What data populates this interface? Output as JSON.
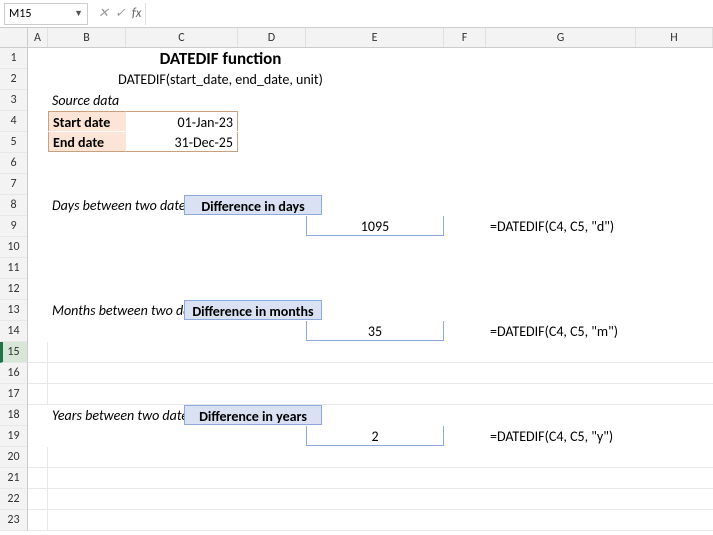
{
  "nameBox": "M15",
  "formulaInput": "",
  "columns": [
    "A",
    "B",
    "C",
    "D",
    "E",
    "F",
    "G",
    "H"
  ],
  "rowCount": 23,
  "activeRow": 15,
  "title": "DATEDIF function",
  "subtitle": "DATEDIF(start_date, end_date, unit)",
  "sourceHeader": "Source data",
  "startLabel": "Start date",
  "startValue": "01-Jan-23",
  "endLabel": "End date",
  "endValue": "31-Dec-25",
  "section1Label": "Days between two dates",
  "diff1Header": "Difference in days",
  "diff1Value": "1095",
  "formula1": "=DATEDIF(C4, C5, \"d\")",
  "section2Label": "Months between two dates",
  "diff2Header": "Difference in months",
  "diff2Value": "35",
  "formula2": "=DATEDIF(C4, C5, \"m\")",
  "section3Label": "Years between two dates",
  "diff3Header": "Difference in years",
  "diff3Value": "2",
  "formula3": "=DATEDIF(C4, C5, \"y\")"
}
